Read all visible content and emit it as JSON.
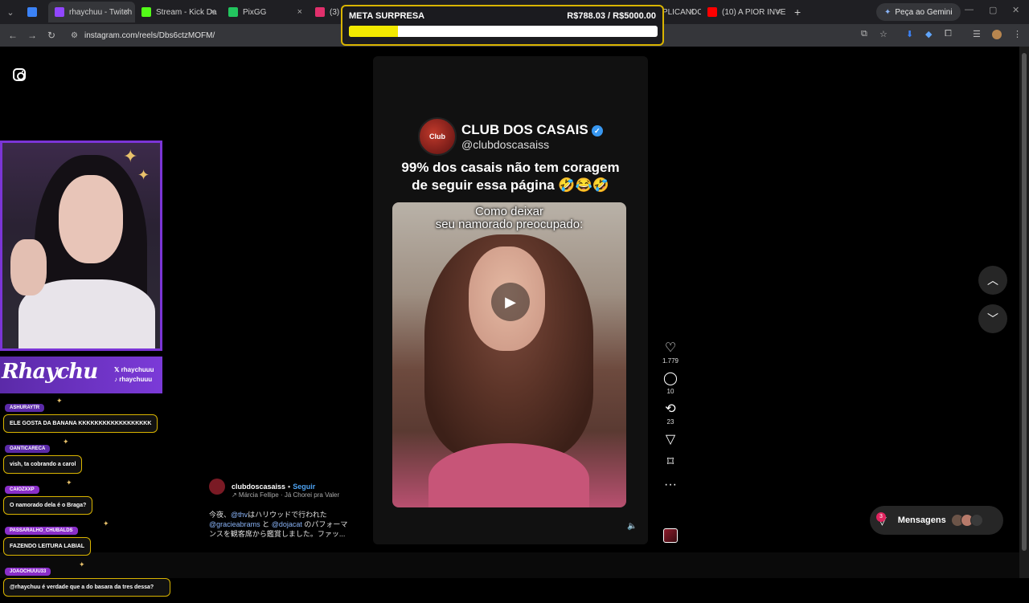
{
  "browser": {
    "tabs": [
      {
        "label": "",
        "color": "#3b82f6"
      },
      {
        "label": "rhaychuu - Twitch",
        "color": "#9146ff"
      },
      {
        "label": "Stream - Kick Da",
        "color": "#53fc18"
      },
      {
        "label": "PixGG",
        "color": "#22c55e"
      },
      {
        "label": "(3) In",
        "color": "#e1306c"
      },
      {
        "label": "(10) EXPLICANDO",
        "color": "#ff0000"
      },
      {
        "label": "(10) A PIOR INVE",
        "color": "#ff0000"
      }
    ],
    "gemini_label": "Peça ao Gemini",
    "url": "instagram.com/reels/Dbs6ctzMOFM/"
  },
  "meta": {
    "title": "META SURPRESA",
    "amount": "R$788.03 / R$5000.00",
    "progress": 0.158
  },
  "reel": {
    "account_name": "CLUB DOS CASAIS",
    "account_handle": "@clubdoscasaiss",
    "logo_text": "Club",
    "caption_line1": "99% dos casais não tem coragem",
    "caption_line2": "de seguir essa página 🤣😂🤣",
    "video_text_line1": "Como deixar",
    "video_text_line2": "seu namorado preocupado:",
    "likes": "1.779",
    "comments": "10",
    "reposts": "23"
  },
  "post": {
    "user": "clubdoscasaiss",
    "follow": "Seguir",
    "sep": "•",
    "song": "↗ Márcia Fellipe · Já Chorei pra Valer",
    "desc_a": "今夜、",
    "tag1": "@thv",
    "desc_b": "はハリウッドで行われた",
    "tag2": "@gracieabrams",
    "desc_c": " と ",
    "tag3": "@dojacat",
    "desc_d": " のパフォーマ",
    "desc_e": "ンスを観客席から鑑賞しました。ファッ..."
  },
  "messages": {
    "label": "Mensagens",
    "badge": "3"
  },
  "stream": {
    "brand": "Rhaychu",
    "social1": "rhaychuuu",
    "social2": "rhaychuuu",
    "chat": [
      {
        "user": "ASHURAYTR",
        "text": "ELE GOSTA DA BANANA KKKKKKKKKKKKKKKKKK"
      },
      {
        "user": "OANTICARECA",
        "text": "vish, ta cobrando a carol"
      },
      {
        "user": "CAIOZXXP",
        "text": "O namorado dela é o Braga?"
      },
      {
        "user": "PASSARALHO_CHUBALDS",
        "text": "FAZENDO LEITURA LABIAL"
      },
      {
        "user": "JOAOCHUUU33",
        "text": "@rhaychuu é verdade que a do basara da tres dessa?"
      }
    ]
  }
}
